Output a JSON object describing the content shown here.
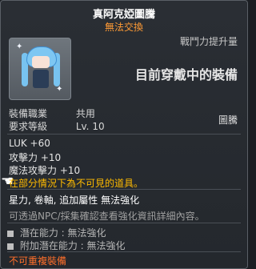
{
  "tooltip": {
    "title": "真阿克婭圖騰",
    "subtitle": "無法交換",
    "stat_header": "戰鬥力提升量",
    "big_label": "目前穿戴中的裝備",
    "job_label": "裝備職業",
    "job_value": "共用",
    "level_label": "要求等級",
    "level_value": "Lv. 10",
    "slot": "圖騰",
    "stats": [
      "LUK  +60",
      "攻擊力  +10",
      "魔法攻擊力  +10"
    ],
    "warning": "在部分情況下為不可見的道具。",
    "enhancement": "星力, 卷軸, 追加屬性 無法強化",
    "info": "可透過NPC/採集確認查看強化資訊詳細內容。",
    "potential_label": "潛在能力 :",
    "potential_value": "無法強化",
    "bonus_label": "附加潛在能力 :",
    "bonus_value": "無法強化",
    "footer": "不可重複裝備"
  }
}
